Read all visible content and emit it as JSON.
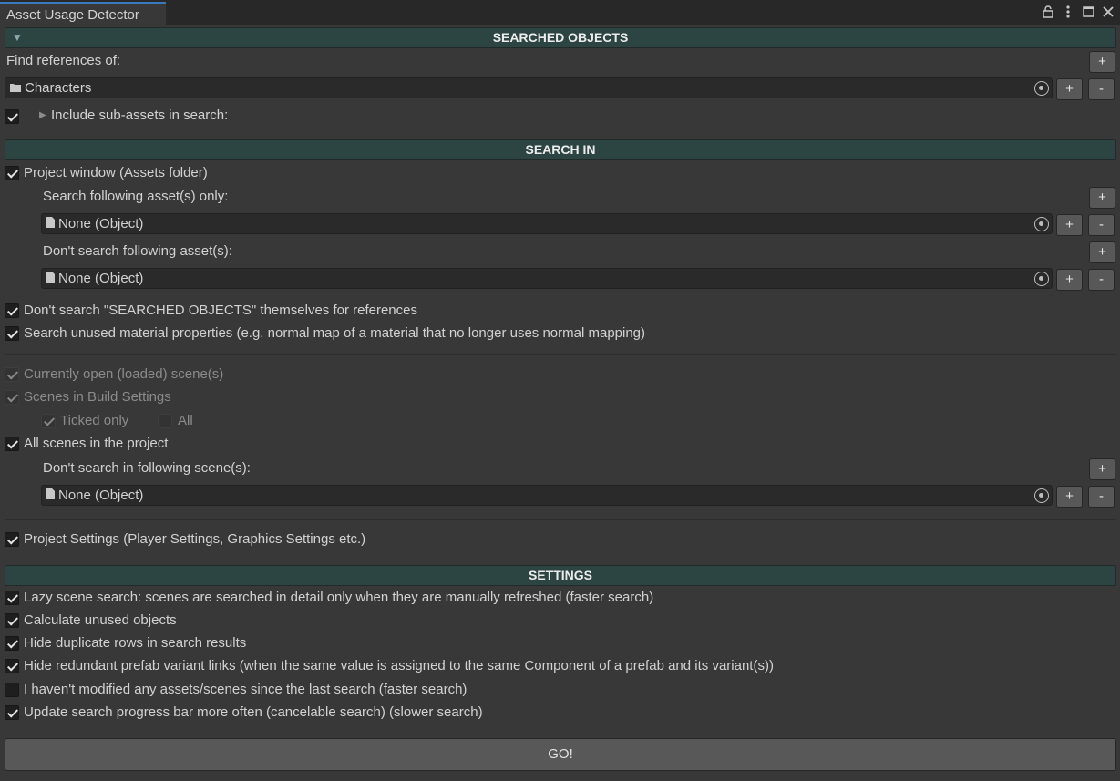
{
  "window": {
    "tab_title": "Asset Usage Detector",
    "icons": [
      "lock-icon",
      "more-options-icon",
      "maximize-icon",
      "close-icon"
    ]
  },
  "searched_objects": {
    "header": "SEARCHED OBJECTS",
    "find_label": "Find references of:",
    "field_value": "Characters",
    "field_icon": "folder-icon",
    "include_sub_assets_label": "Include sub-assets in search:",
    "include_sub_assets_checked": true
  },
  "search_in": {
    "header": "SEARCH IN",
    "project_window_label": "Project window (Assets folder)",
    "search_only_label": "Search following asset(s) only:",
    "search_only_value": "None (Object)",
    "dont_search_label": "Don't search following asset(s):",
    "dont_search_value": "None (Object)",
    "dont_search_searched_label": "Don't search \"SEARCHED OBJECTS\" themselves for references",
    "unused_material_label": "Search unused material properties (e.g. normal map of a material that no longer uses normal mapping)",
    "open_scenes_label": "Currently open (loaded) scene(s)",
    "build_scenes_label": "Scenes in Build Settings",
    "ticked_only_label": "Ticked only",
    "all_label": "All",
    "all_scenes_label": "All scenes in the project",
    "dont_search_scenes_label": "Don't search in following scene(s):",
    "dont_search_scenes_value": "None (Object)",
    "project_settings_label": "Project Settings (Player Settings, Graphics Settings etc.)"
  },
  "settings": {
    "header": "SETTINGS",
    "lazy_scene_label": "Lazy scene search: scenes are searched in detail only when they are manually refreshed (faster search)",
    "calc_unused_label": "Calculate unused objects",
    "hide_duplicate_label": "Hide duplicate rows in search results",
    "hide_redundant_label": "Hide redundant prefab variant links (when the same value is assigned to the same Component of a prefab and its variant(s))",
    "not_modified_label": "I haven't modified any assets/scenes since the last search (faster search)",
    "update_progress_label": "Update search progress bar more often (cancelable search) (slower search)"
  },
  "buttons": {
    "plus": "+",
    "minus": "-",
    "go": "GO!"
  }
}
